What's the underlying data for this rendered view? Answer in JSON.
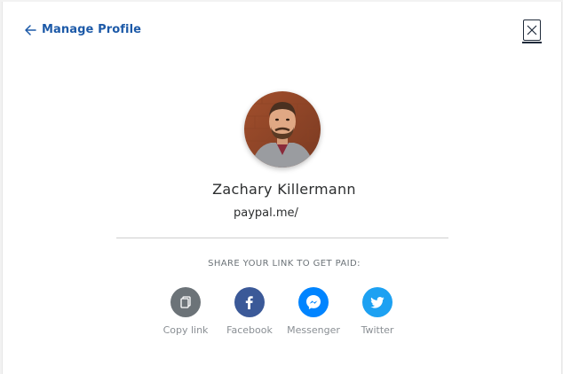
{
  "header": {
    "back_label": "Manage Profile",
    "back_icon": "arrow-left-icon",
    "close_icon": "close-icon"
  },
  "profile": {
    "name": "Zachary Killermann",
    "url": "paypal.me/"
  },
  "share": {
    "heading": "SHARE YOUR LINK TO GET PAID:",
    "items": [
      {
        "label": "Copy link",
        "icon": "copy-icon",
        "color": "#6c7378"
      },
      {
        "label": "Facebook",
        "icon": "facebook-icon",
        "color": "#3b5998"
      },
      {
        "label": "Messenger",
        "icon": "messenger-icon",
        "color": "#0084ff"
      },
      {
        "label": "Twitter",
        "icon": "twitter-icon",
        "color": "#1da1f2"
      }
    ]
  },
  "colors": {
    "link": "#1d5aa8",
    "text": "#2c2e2f",
    "muted": "#6c7378"
  }
}
